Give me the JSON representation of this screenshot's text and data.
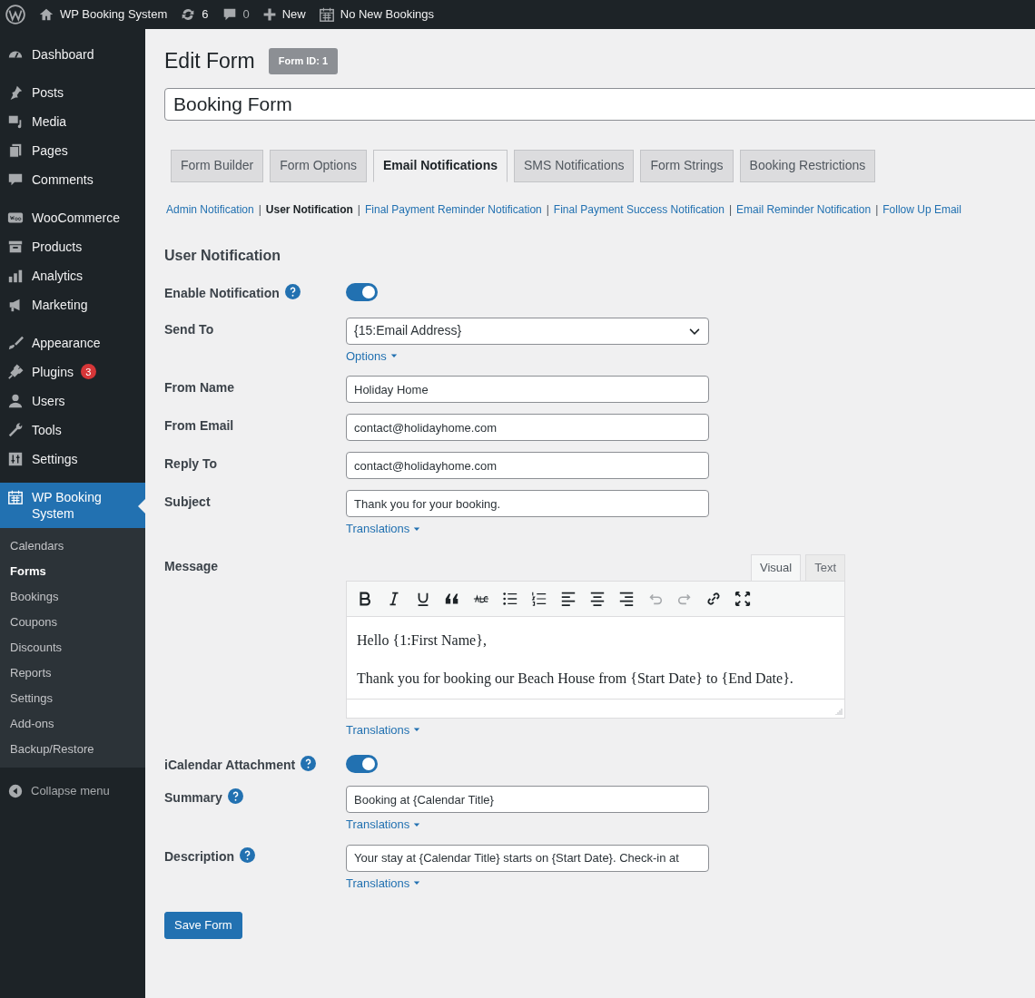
{
  "admin_bar": {
    "site": "WP Booking System",
    "updates": "6",
    "comments": "0",
    "new": "New",
    "bookings": "No New Bookings"
  },
  "sidebar": {
    "groups": [
      [
        {
          "label": "Dashboard",
          "selected": false
        }
      ],
      [
        {
          "label": "Posts",
          "selected": false
        },
        {
          "label": "Media",
          "selected": false
        },
        {
          "label": "Pages",
          "selected": false
        },
        {
          "label": "Comments",
          "selected": false
        }
      ],
      [
        {
          "label": "WooCommerce",
          "selected": false
        },
        {
          "label": "Products",
          "selected": false
        },
        {
          "label": "Analytics",
          "selected": false
        },
        {
          "label": "Marketing",
          "selected": false
        }
      ],
      [
        {
          "label": "Appearance",
          "selected": false
        },
        {
          "label": "Plugins",
          "selected": false,
          "badge": "3"
        },
        {
          "label": "Users",
          "selected": false
        },
        {
          "label": "Tools",
          "selected": false
        },
        {
          "label": "Settings",
          "selected": false
        }
      ],
      [
        {
          "label": "WP Booking System",
          "selected": true,
          "submenu": [
            {
              "label": "Calendars",
              "selected": false
            },
            {
              "label": "Forms",
              "selected": true
            },
            {
              "label": "Bookings",
              "selected": false
            },
            {
              "label": "Coupons",
              "selected": false
            },
            {
              "label": "Discounts",
              "selected": false
            },
            {
              "label": "Reports",
              "selected": false
            },
            {
              "label": "Settings",
              "selected": false
            },
            {
              "label": "Add-ons",
              "selected": false
            },
            {
              "label": "Backup/Restore",
              "selected": false
            }
          ]
        }
      ]
    ],
    "collapse": "Collapse menu"
  },
  "page": {
    "title": "Edit Form",
    "badge": "Form ID: 1",
    "form_name": "Booking Form"
  },
  "tabs": [
    {
      "label": "Form Builder",
      "selected": false
    },
    {
      "label": "Form Options",
      "selected": false
    },
    {
      "label": "Email Notifications",
      "selected": true
    },
    {
      "label": "SMS Notifications",
      "selected": false
    },
    {
      "label": "Form Strings",
      "selected": false
    },
    {
      "label": "Booking Restrictions",
      "selected": false
    }
  ],
  "subtabs": [
    {
      "label": "Admin Notification",
      "selected": false
    },
    {
      "label": "User Notification",
      "selected": true
    },
    {
      "label": "Final Payment Reminder Notification",
      "selected": false
    },
    {
      "label": "Final Payment Success Notification",
      "selected": false
    },
    {
      "label": "Email Reminder Notification",
      "selected": false
    },
    {
      "label": "Follow Up Email",
      "selected": false
    }
  ],
  "subtab_separator": "|",
  "section_title": "User Notification",
  "fields": [
    {
      "kind": "toggle",
      "label": "Enable Notification",
      "help": true,
      "on": true
    },
    {
      "kind": "select",
      "label": "Send To",
      "help": false,
      "value": "{15:Email Address}",
      "link": "Options"
    },
    {
      "kind": "text",
      "label": "From Name",
      "help": false,
      "value": "Holiday Home"
    },
    {
      "kind": "text",
      "label": "From Email",
      "help": false,
      "value": "contact@holidayhome.com"
    },
    {
      "kind": "text",
      "label": "Reply To",
      "help": false,
      "value": "contact@holidayhome.com"
    },
    {
      "kind": "text",
      "label": "Subject",
      "help": false,
      "value": "Thank you for your booking.",
      "link": "Translations"
    },
    {
      "kind": "editor",
      "label": "Message",
      "help": false,
      "modes": [
        {
          "label": "Visual",
          "selected": true
        },
        {
          "label": "Text",
          "selected": false
        }
      ],
      "paragraphs": [
        "Hello {1:First Name},",
        "Thank you for booking our Beach House from {Start Date} to {End Date}."
      ],
      "link": "Translations"
    },
    {
      "kind": "toggle",
      "label": "iCalendar Attachment",
      "help": true,
      "on": true
    },
    {
      "kind": "text",
      "label": "Summary",
      "help": true,
      "value": "Booking at {Calendar Title}",
      "link": "Translations"
    },
    {
      "kind": "text",
      "label": "Description",
      "help": true,
      "value": "Your stay at {Calendar Title} starts on {Start Date}. Check-in at",
      "link": "Translations"
    }
  ],
  "save_button": "Save Form"
}
